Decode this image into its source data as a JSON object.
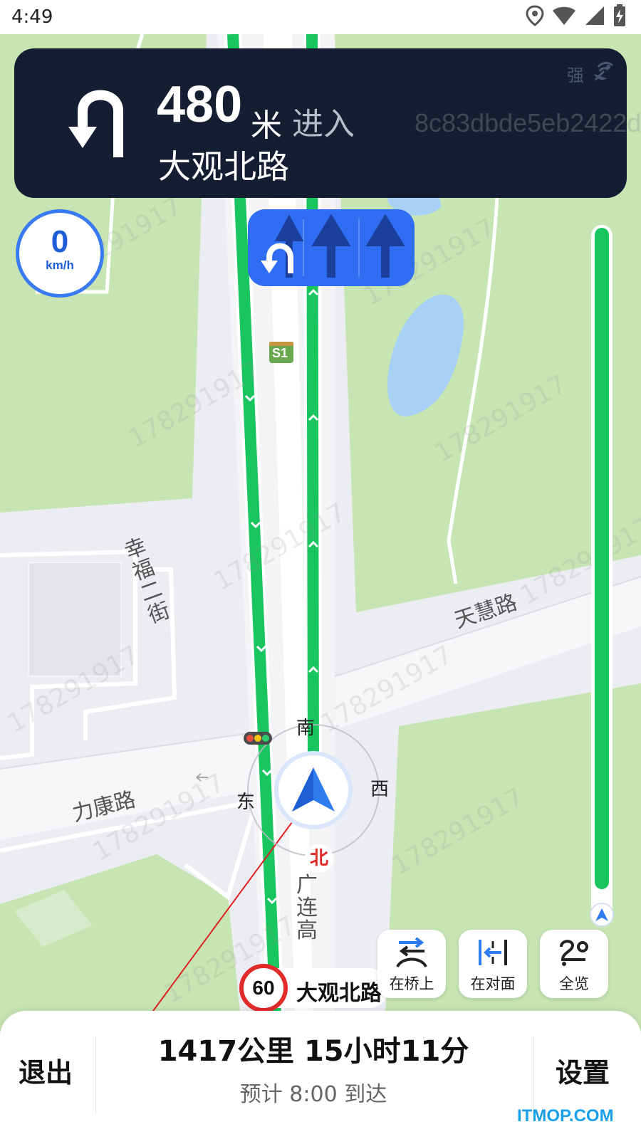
{
  "status_bar": {
    "time": "4:49"
  },
  "nav": {
    "distance": "480",
    "distance_unit": "米",
    "action": "进入",
    "next_road": "大观北路",
    "signal_label": "强",
    "hash_text": "8c83dbde5eb2422d"
  },
  "lanes": [
    {
      "arrow": "u-turn",
      "recommended": true
    },
    {
      "arrow": "straight",
      "recommended": false
    },
    {
      "arrow": "straight",
      "recommended": false
    }
  ],
  "speedometer": {
    "value": "0",
    "unit": "km/h"
  },
  "map": {
    "labels": {
      "road_xingfu": "幸福二街",
      "road_tianhui": "天慧路",
      "road_likang": "力康路",
      "road_guanglian": "广连高",
      "metro": "S1"
    },
    "compass": {
      "south": "南",
      "west": "西",
      "east": "东",
      "north": "北"
    },
    "watermark": "178291917"
  },
  "route_progress": {
    "remaining_fraction": 0.96
  },
  "current_road": {
    "name": "大观北路",
    "speed_limit": "60"
  },
  "map_buttons": [
    {
      "label": "在桥上",
      "icon": "bridge-switch-icon"
    },
    {
      "label": "在对面",
      "icon": "opposite-side-icon"
    },
    {
      "label": "全览",
      "icon": "route-overview-icon"
    }
  ],
  "bottom": {
    "exit_label": "退出",
    "settings_label": "设置",
    "trip_summary": "1417公里 15小时11分",
    "eta": "预计 8:00 到达",
    "site_mark": "ITMOP.COM"
  },
  "colors": {
    "route_green": "#19c55e",
    "banner": "#151d33",
    "lane_blue": "#2f6ef2",
    "park_green": "#c6e5b3",
    "water": "#a9d1f5"
  }
}
